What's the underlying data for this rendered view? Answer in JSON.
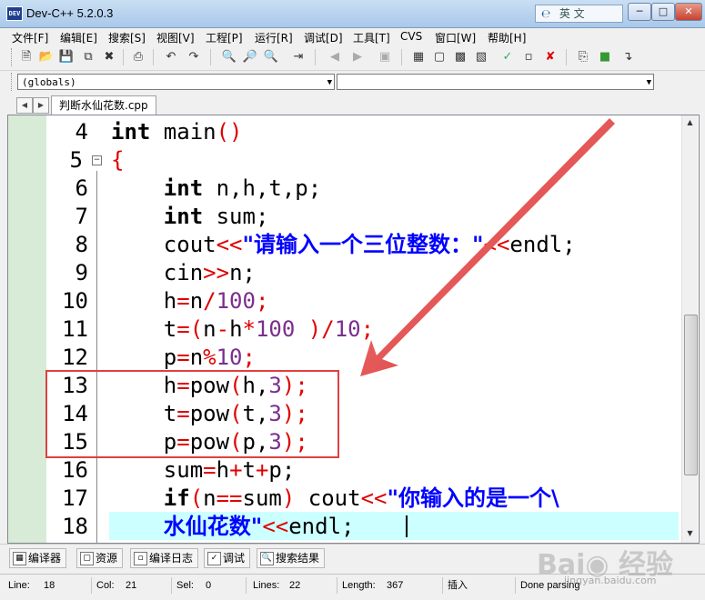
{
  "window": {
    "title": "Dev-C++ 5.2.0.3",
    "app_icon_text": "DEV",
    "ime_label": "英 文",
    "ime_logo": "℮"
  },
  "menu": [
    "文件[F]",
    "编辑[E]",
    "搜索[S]",
    "视图[V]",
    "工程[P]",
    "运行[R]",
    "调试[D]",
    "工具[T]",
    "CVS",
    "窗口[W]",
    "帮助[H]"
  ],
  "combos": {
    "scope": "(globals)",
    "member": ""
  },
  "tabs": {
    "file": "判断水仙花数.cpp"
  },
  "editor": {
    "lines": [
      {
        "n": "4"
      },
      {
        "n": "5"
      },
      {
        "n": "6"
      },
      {
        "n": "7"
      },
      {
        "n": "8"
      },
      {
        "n": "9"
      },
      {
        "n": "10"
      },
      {
        "n": "11"
      },
      {
        "n": "12"
      },
      {
        "n": "13"
      },
      {
        "n": "14"
      },
      {
        "n": "15"
      },
      {
        "n": "16"
      },
      {
        "n": "17"
      },
      {
        "n": "18"
      }
    ],
    "code": {
      "l4_kw": "int",
      "l4_rest": " main",
      "l4_paren": "()",
      "l5_brace": "{",
      "l6_kw": "int",
      "l6_rest": " n,h,t,p;",
      "l7_kw": "int",
      "l7_rest": " sum;",
      "l8_a": "cout",
      "l8_op": "<<",
      "l8_str": "\"请输入一个三位整数：\"",
      "l8_op2": "<<",
      "l8_b": "endl;",
      "l9_a": "cin",
      "l9_op": ">>",
      "l9_b": "n;",
      "l10_a": "h",
      "l10_op": "=",
      "l10_b": "n",
      "l10_op2": "/",
      "l10_num": "100",
      "l10_c": ";",
      "l11_a": "t",
      "l11_op": "=(",
      "l11_b": "n",
      "l11_op2": "-",
      "l11_c": "h",
      "l11_op3": "*",
      "l11_num": "100",
      "l11_d": " ",
      "l11_op4": ")/",
      "l11_num2": "10",
      "l11_e": ";",
      "l12_a": "p",
      "l12_op": "=",
      "l12_b": "n",
      "l12_op2": "%",
      "l12_num": "10",
      "l12_c": ";",
      "l13_a": "h",
      "l13_op": "=",
      "l13_b": "pow",
      "l13_op2": "(",
      "l13_c": "h,",
      "l13_num": "3",
      "l13_op3": ");",
      "l14_a": "t",
      "l14_op": "=",
      "l14_b": "pow",
      "l14_op2": "(",
      "l14_c": "t,",
      "l14_num": "3",
      "l14_op3": ");",
      "l15_a": "p",
      "l15_op": "=",
      "l15_b": "pow",
      "l15_op2": "(",
      "l15_c": "p,",
      "l15_num": "3",
      "l15_op3": ");",
      "l16_a": "sum",
      "l16_op": "=",
      "l16_b": "h",
      "l16_op2": "+",
      "l16_c": "t",
      "l16_op3": "+",
      "l16_d": "p;",
      "l17_kw": "if",
      "l17_op": "(",
      "l17_a": "n",
      "l17_op2": "==",
      "l17_b": "sum",
      "l17_op3": ")",
      "l17_c": " cout",
      "l17_op4": "<<",
      "l17_str": "\"你输入的是一个\\",
      "l18_str": "水仙花数\"",
      "l18_op": "<<",
      "l18_a": "endl;"
    }
  },
  "bottom_tabs": [
    "编译器",
    "资源",
    "编译日志",
    "调试",
    "搜索结果"
  ],
  "status": {
    "line_label": "Line:",
    "line_val": "18",
    "col_label": "Col:",
    "col_val": "21",
    "sel_label": "Sel:",
    "sel_val": "0",
    "lines_label": "Lines:",
    "lines_val": "22",
    "length_label": "Length:",
    "length_val": "367",
    "mode": "插入",
    "parse": "Done parsing"
  },
  "watermark": {
    "text": "Bai◉ 经验",
    "sub": "jingyan.baidu.com"
  },
  "colors": {
    "keyword": "#000000",
    "number": "#7b2e8e",
    "operator": "#e00000",
    "string": "#0000ff",
    "current_line": "#ccffff",
    "annotation": "#e04040"
  }
}
